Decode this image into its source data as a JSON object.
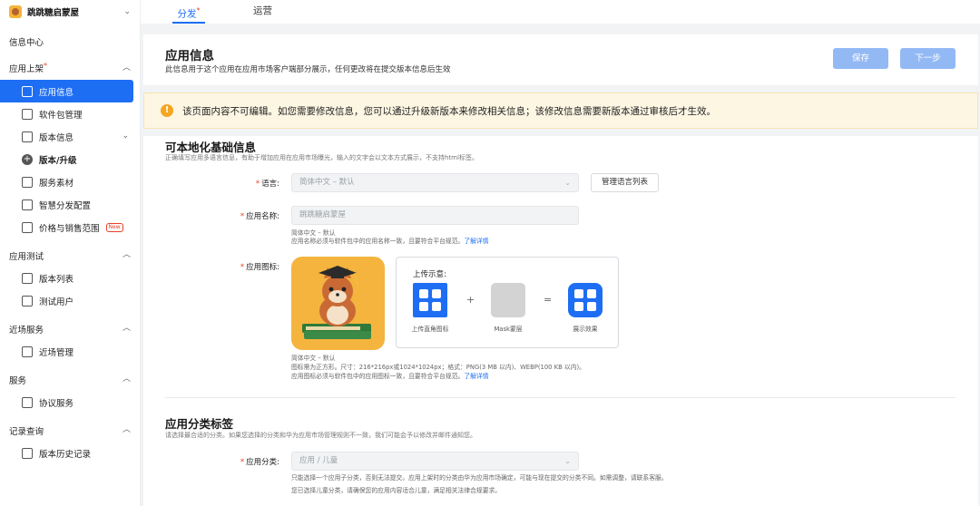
{
  "app": {
    "name": "跳跳糖启蒙屋"
  },
  "topbar": {
    "tabs": [
      "分发",
      "运营"
    ],
    "active_dot": "*"
  },
  "sidebar": {
    "info_center": "信息中心",
    "groups": [
      {
        "label": "应用上架",
        "dot": "*",
        "items": [
          {
            "label": "应用信息",
            "icon": "app-info-icon",
            "active": true
          },
          {
            "label": "软件包管理",
            "icon": "package-icon"
          },
          {
            "label": "版本信息",
            "icon": "version-icon",
            "chevron": true
          },
          {
            "label": "版本/升级",
            "icon": "plus-circle-icon"
          },
          {
            "label": "服务素材",
            "icon": "material-icon"
          },
          {
            "label": "智慧分发配置",
            "icon": "config-icon"
          },
          {
            "label": "价格与销售范围",
            "icon": "price-icon",
            "badge": "New"
          }
        ]
      },
      {
        "label": "应用测试",
        "items": [
          {
            "label": "版本列表",
            "icon": "list-icon"
          },
          {
            "label": "测试用户",
            "icon": "user-icon"
          }
        ]
      },
      {
        "label": "近场服务",
        "items": [
          {
            "label": "近场管理",
            "icon": "nearby-icon"
          }
        ]
      },
      {
        "label": "服务",
        "items": [
          {
            "label": "协议服务",
            "icon": "agreement-icon"
          }
        ]
      },
      {
        "label": "记录查询",
        "items": [
          {
            "label": "版本历史记录",
            "icon": "history-icon"
          }
        ]
      }
    ]
  },
  "header": {
    "title": "应用信息",
    "desc": "此信息用于这个应用在应用市场客户端部分展示，任何更改将在提交版本信息后生效",
    "save_label": "保存",
    "next_label": "下一步"
  },
  "warning": {
    "text": "该页面内容不可编辑。如您需要修改信息，您可以通过升级新版本来修改相关信息；该修改信息需要新版本通过审核后才生效。"
  },
  "localization": {
    "title": "可本地化基础信息",
    "desc": "正确填写应用多语言信息，有助于增加应用在应用市场曝光，输入的文字会以文本方式展示，不支持html标签。",
    "language": {
      "label": "语言:",
      "value": "简体中文 – 默认",
      "manage_label": "管理语言列表"
    },
    "app_name": {
      "label": "应用名称:",
      "value": "跳跳糖启蒙屋",
      "hint1": "简体中文 – 默认",
      "hint2": "应用名称必须与软件包中的应用名称一致，且要符合平台规范。",
      "hint_link": "了解详情"
    },
    "app_icon": {
      "label": "应用图标:",
      "demo_title": "上传示意:",
      "demo_caption_1": "上传直角图标",
      "demo_caption_2": "Mask蒙层",
      "demo_caption_3": "展示效果",
      "plus": "+",
      "equals": "=",
      "hint1": "简体中文 – 默认",
      "hint2": "图标需为正方形。尺寸：216*216px或1024*1024px；格式：PNG(3 MB 以内)、WEBP(100 KB 以内)。",
      "hint3": "应用图标必须与软件包中的应用图标一致，且要符合平台规范。",
      "hint_link": "了解详情"
    }
  },
  "category": {
    "title": "应用分类标签",
    "desc": "请选择最合适的分类。如果您选择的分类和华为应用市场管理规则不一致，我们可能会予以修改并邮件通知您。",
    "label": "应用分类:",
    "value": "应用 / 儿童",
    "hint1": "只能选择一个应用子分类，否则无法提交。应用上架时的分类由华为应用市场确定，可能与现在提交的分类不同。如需调整，请联系客服。",
    "hint2": "您已选择儿童分类，请确保您的应用内容适合儿童，满足相关法律合规要求。"
  },
  "colors": {
    "accent": "#1e6ef4",
    "button_disabled": "#93b9f5",
    "warning_bg": "#fdf6e3",
    "required": "#e84026"
  }
}
